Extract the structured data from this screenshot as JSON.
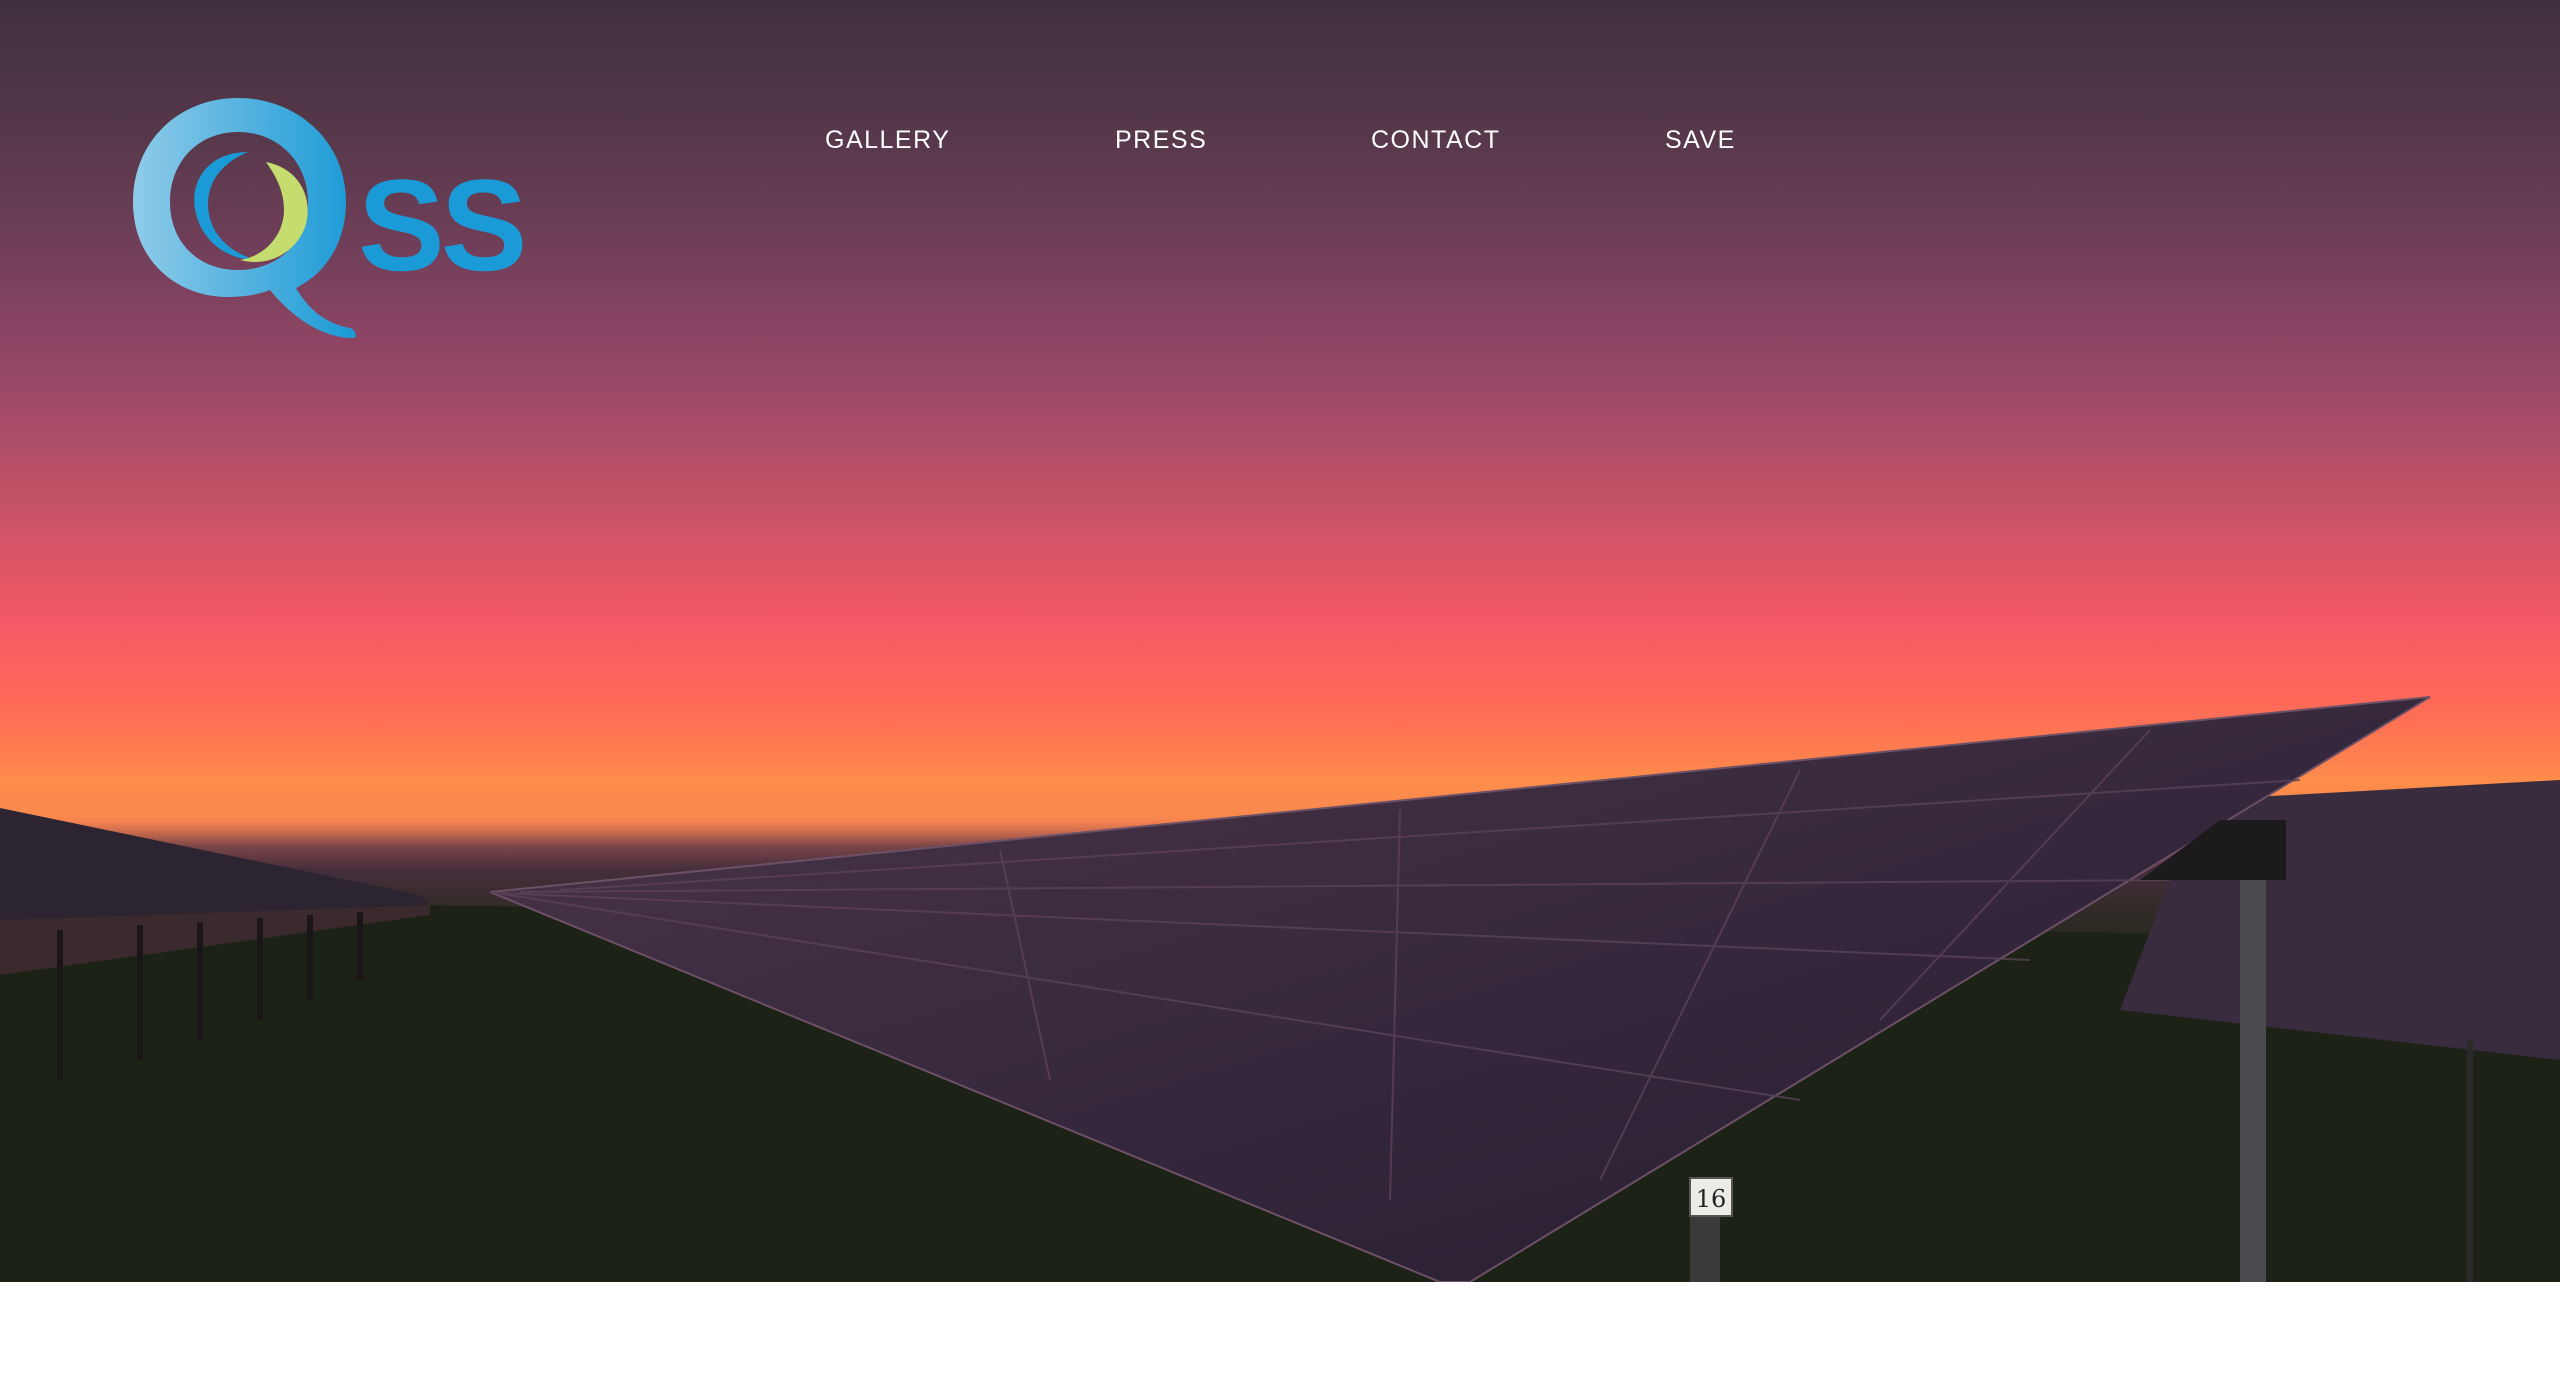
{
  "brand": {
    "logo_text": "QSS",
    "colors": {
      "primary_blue": "#1a9ad6",
      "light_blue": "#8fcbe9",
      "lime": "#c5dc6e"
    }
  },
  "nav": {
    "items": [
      {
        "label": "GALLERY"
      },
      {
        "label": "PRESS"
      },
      {
        "label": "CONTACT"
      },
      {
        "label": "SAVE"
      }
    ]
  },
  "hero": {
    "panel_label": "16"
  }
}
